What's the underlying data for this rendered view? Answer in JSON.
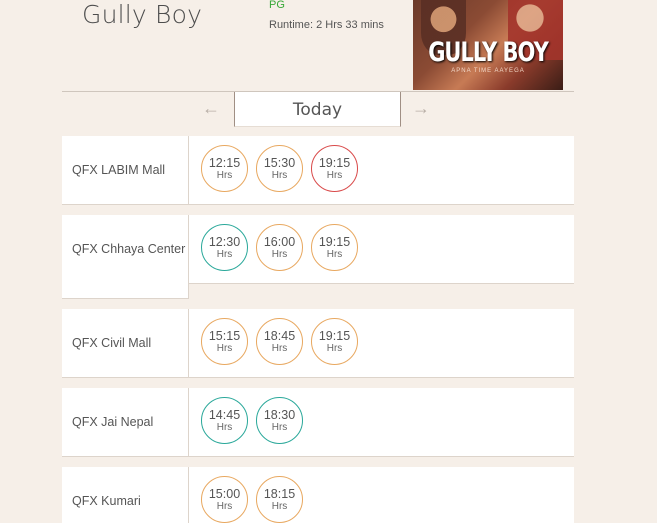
{
  "movie": {
    "title": "Gully Boy",
    "rating": "PG",
    "runtime": "Runtime: 2 Hrs 33 mins",
    "poster_title": "GULLY BOY",
    "poster_subtitle": "APNA TIME AAYEGA"
  },
  "date_nav": {
    "current": "Today",
    "prev_icon": "←",
    "next_icon": "→"
  },
  "colors": {
    "available": "#e8a860",
    "fast_filling": "#2aa89a",
    "almost_full": "#d94a4a"
  },
  "cinemas": [
    {
      "name": "QFX LABIM Mall",
      "showtimes": [
        {
          "time": "12:15",
          "unit": "Hrs",
          "status": "available"
        },
        {
          "time": "15:30",
          "unit": "Hrs",
          "status": "available"
        },
        {
          "time": "19:15",
          "unit": "Hrs",
          "status": "almost_full"
        }
      ]
    },
    {
      "name": "QFX Chhaya Center",
      "showtimes": [
        {
          "time": "12:30",
          "unit": "Hrs",
          "status": "fast_filling"
        },
        {
          "time": "16:00",
          "unit": "Hrs",
          "status": "available"
        },
        {
          "time": "19:15",
          "unit": "Hrs",
          "status": "available"
        }
      ]
    },
    {
      "name": "QFX Civil Mall",
      "showtimes": [
        {
          "time": "15:15",
          "unit": "Hrs",
          "status": "available"
        },
        {
          "time": "18:45",
          "unit": "Hrs",
          "status": "available"
        },
        {
          "time": "19:15",
          "unit": "Hrs",
          "status": "available"
        }
      ]
    },
    {
      "name": "QFX Jai Nepal",
      "showtimes": [
        {
          "time": "14:45",
          "unit": "Hrs",
          "status": "fast_filling"
        },
        {
          "time": "18:30",
          "unit": "Hrs",
          "status": "fast_filling"
        }
      ]
    },
    {
      "name": "QFX Kumari",
      "showtimes": [
        {
          "time": "15:00",
          "unit": "Hrs",
          "status": "available"
        },
        {
          "time": "18:15",
          "unit": "Hrs",
          "status": "available"
        }
      ]
    }
  ]
}
